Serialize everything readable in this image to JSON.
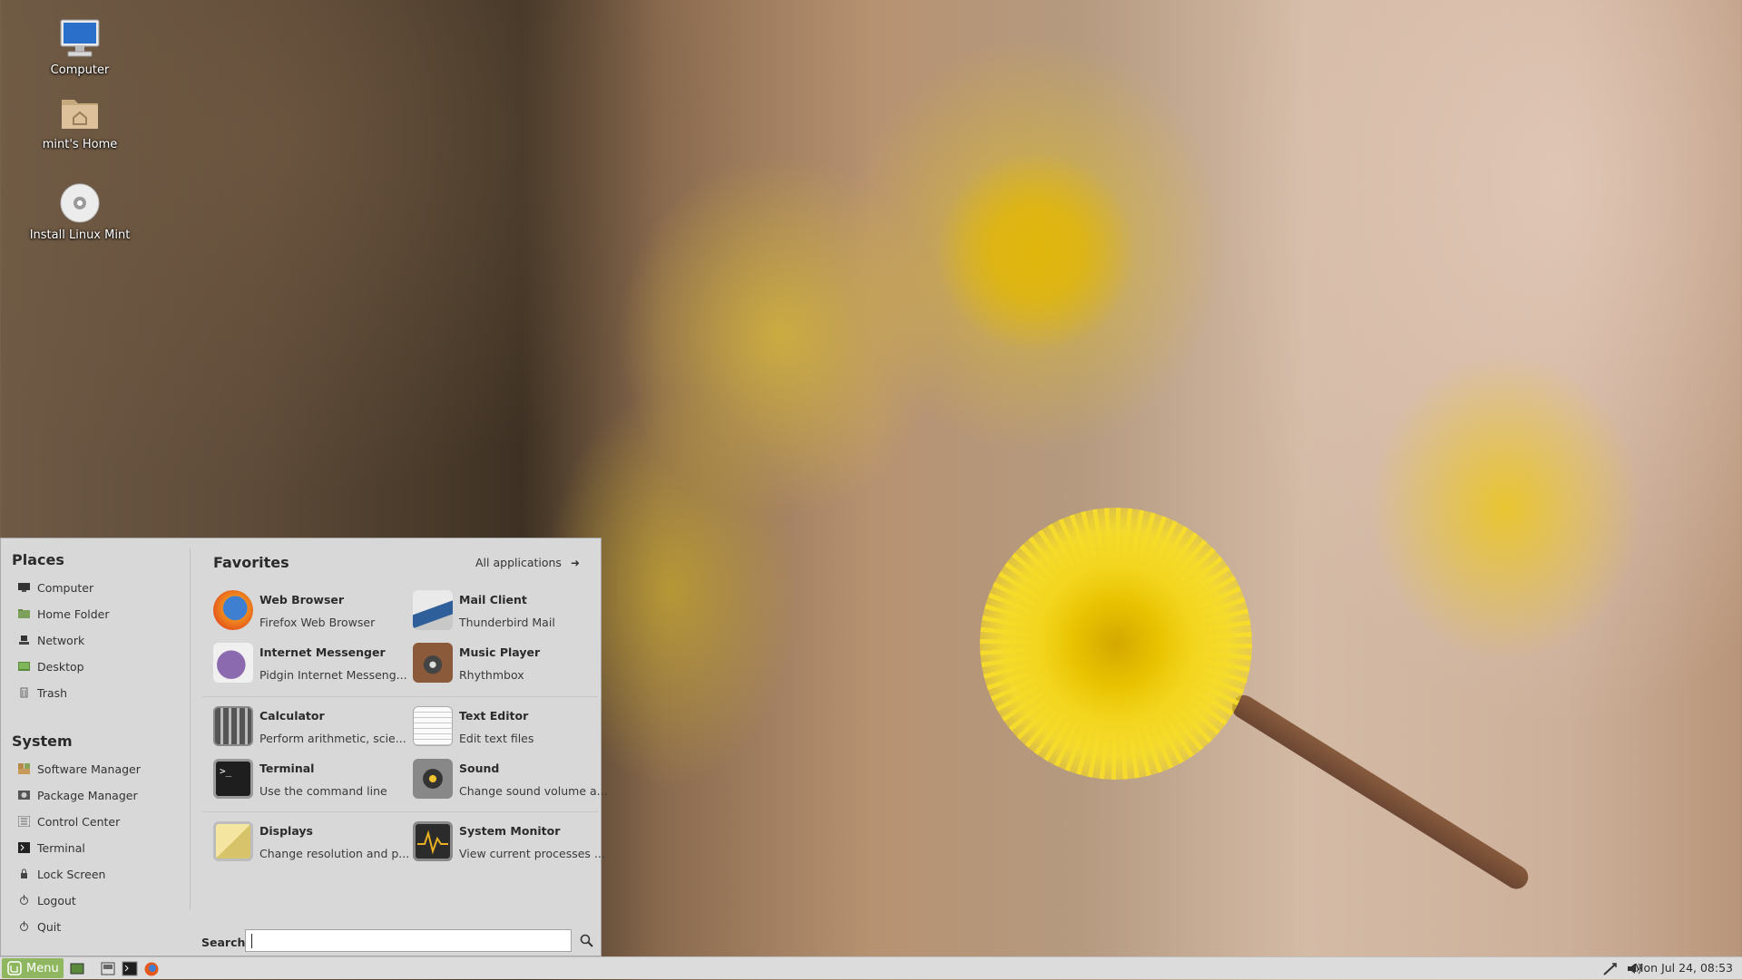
{
  "desktop": {
    "icons": [
      {
        "label": "Computer",
        "icon": "computer-icon"
      },
      {
        "label": "mint's Home",
        "icon": "home-folder-icon"
      },
      {
        "label": "Install Linux Mint",
        "icon": "disc-icon"
      }
    ]
  },
  "menu": {
    "places": {
      "title": "Places",
      "items": [
        {
          "label": "Computer",
          "icon": "computer-icon"
        },
        {
          "label": "Home Folder",
          "icon": "home-folder-icon"
        },
        {
          "label": "Network",
          "icon": "network-icon"
        },
        {
          "label": "Desktop",
          "icon": "desktop-icon"
        },
        {
          "label": "Trash",
          "icon": "trash-icon"
        }
      ]
    },
    "system": {
      "title": "System",
      "items": [
        {
          "label": "Software Manager",
          "icon": "software-manager-icon"
        },
        {
          "label": "Package Manager",
          "icon": "package-manager-icon"
        },
        {
          "label": "Control Center",
          "icon": "control-center-icon"
        },
        {
          "label": "Terminal",
          "icon": "terminal-icon"
        },
        {
          "label": "Lock Screen",
          "icon": "lock-icon"
        },
        {
          "label": "Logout",
          "icon": "logout-icon"
        },
        {
          "label": "Quit",
          "icon": "power-icon"
        }
      ]
    },
    "favorites": {
      "title": "Favorites",
      "all_applications": "All applications",
      "apps": [
        {
          "name": "Web Browser",
          "desc": "Firefox Web Browser",
          "icon": "firefox-icon"
        },
        {
          "name": "Mail Client",
          "desc": "Thunderbird Mail",
          "icon": "thunderbird-icon"
        },
        {
          "name": "Internet Messenger",
          "desc": "Pidgin Internet Messeng...",
          "icon": "pidgin-icon"
        },
        {
          "name": "Music Player",
          "desc": "Rhythmbox",
          "icon": "speaker-icon"
        },
        {
          "name": "Calculator",
          "desc": "Perform arithmetic, scie...",
          "icon": "calculator-icon"
        },
        {
          "name": "Text Editor",
          "desc": "Edit text files",
          "icon": "text-editor-icon"
        },
        {
          "name": "Terminal",
          "desc": "Use the command line",
          "icon": "terminal-icon"
        },
        {
          "name": "Sound",
          "desc": "Change sound volume a...",
          "icon": "sound-icon"
        },
        {
          "name": "Displays",
          "desc": "Change resolution and p...",
          "icon": "displays-icon"
        },
        {
          "name": "System Monitor",
          "desc": "View current processes ...",
          "icon": "system-monitor-icon"
        }
      ]
    },
    "search": {
      "label": "Search:",
      "value": ""
    }
  },
  "taskbar": {
    "menu_label": "Menu",
    "clock": "Mon Jul 24, 08:53"
  },
  "colors": {
    "menu_button": "#8fb760",
    "menu_bg": "#d8d8d8",
    "taskbar_bg": "#dcdcdc"
  }
}
